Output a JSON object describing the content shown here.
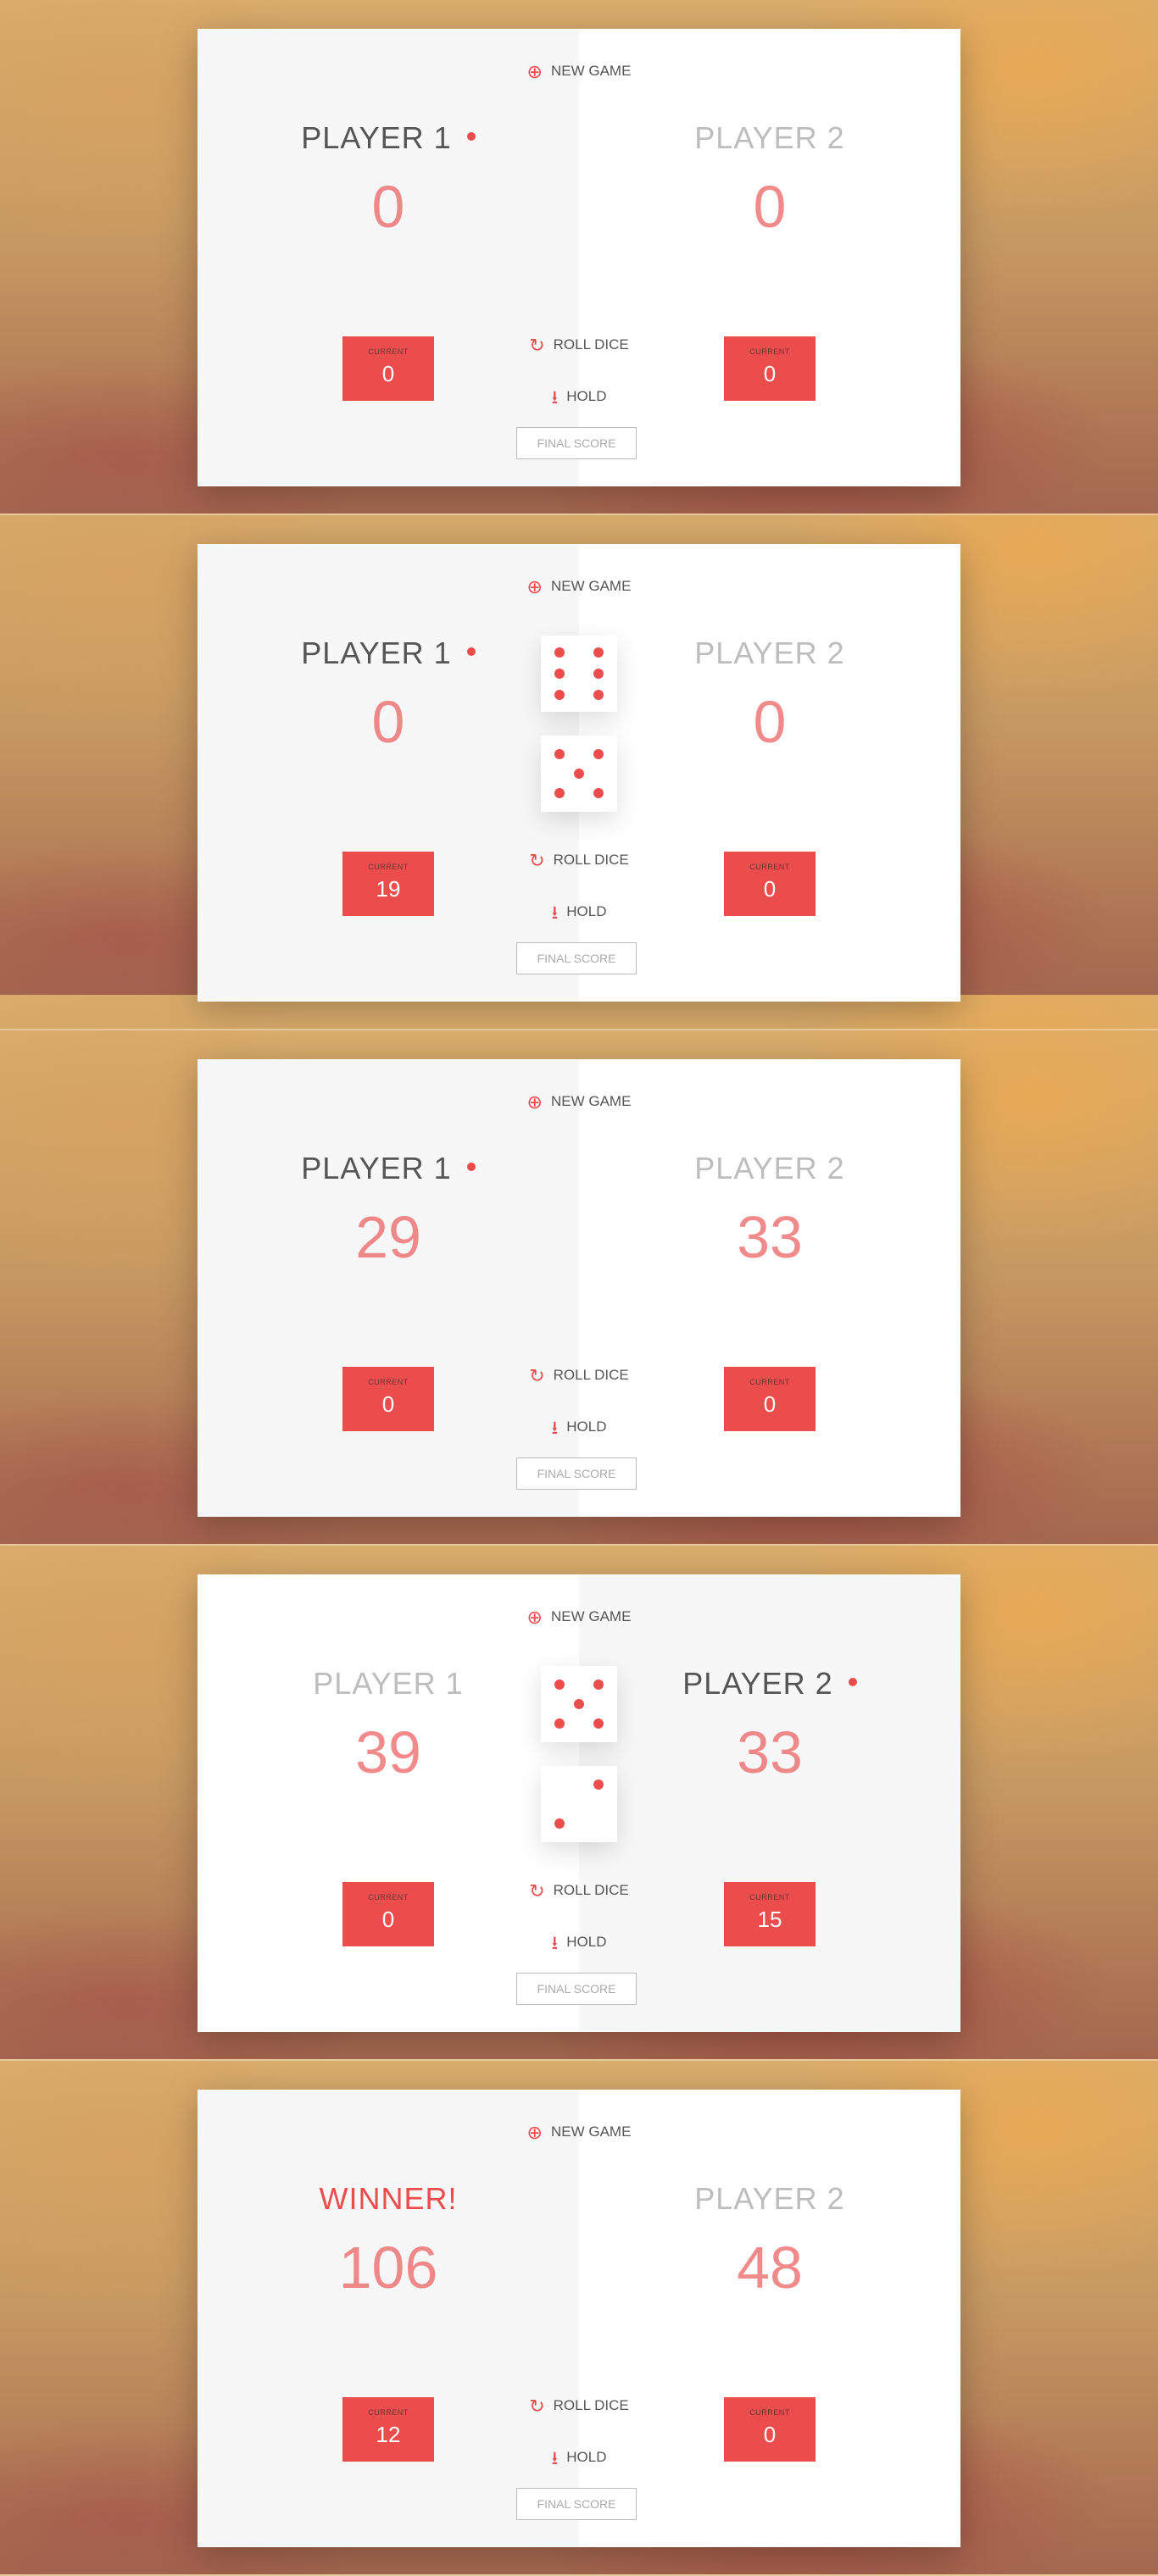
{
  "colors": {
    "accent": "#EB4D4D",
    "panel": "#ffffff",
    "active_side": "#f7f7f7"
  },
  "labels": {
    "new_game": "NEW GAME",
    "roll_dice": "ROLL DICE",
    "hold": "HOLD",
    "final_score": "FINAL SCORE",
    "current": "CURRENT"
  },
  "icons": {
    "new_game": "plus-circle-icon",
    "roll_dice": "refresh-icon",
    "hold": "download-icon"
  },
  "frames": [
    {
      "active_player": 1,
      "players": [
        {
          "name": "PLAYER 1",
          "score": "0",
          "current": "0"
        },
        {
          "name": "PLAYER 2",
          "score": "0",
          "current": "0"
        }
      ],
      "dice": []
    },
    {
      "active_player": 1,
      "players": [
        {
          "name": "PLAYER 1",
          "score": "0",
          "current": "19"
        },
        {
          "name": "PLAYER 2",
          "score": "0",
          "current": "0"
        }
      ],
      "dice": [
        6,
        5
      ]
    },
    {
      "active_player": 1,
      "players": [
        {
          "name": "PLAYER 1",
          "score": "29",
          "current": "0"
        },
        {
          "name": "PLAYER 2",
          "score": "33",
          "current": "0"
        }
      ],
      "dice": []
    },
    {
      "active_player": 2,
      "players": [
        {
          "name": "PLAYER 1",
          "score": "39",
          "current": "0"
        },
        {
          "name": "PLAYER 2",
          "score": "33",
          "current": "15"
        }
      ],
      "dice": [
        5,
        2
      ]
    },
    {
      "active_player": 1,
      "winner": 1,
      "players": [
        {
          "name": "WINNER!",
          "score": "106",
          "current": "12"
        },
        {
          "name": "PLAYER 2",
          "score": "48",
          "current": "0"
        }
      ],
      "dice": []
    }
  ]
}
